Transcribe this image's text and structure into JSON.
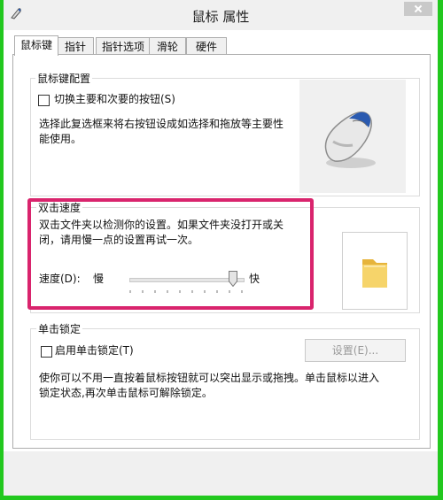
{
  "window": {
    "title": "鼠标 属性"
  },
  "tabs": [
    {
      "label": "鼠标键"
    },
    {
      "label": "指针"
    },
    {
      "label": "指针选项"
    },
    {
      "label": "滑轮"
    },
    {
      "label": "硬件"
    }
  ],
  "button_config": {
    "group_label": "鼠标键配置",
    "checkbox_label": "切换主要和次要的按钮(S)",
    "checked": false,
    "description_line1": "选择此复选框来将右按钮设成如选择和拖放等主要性",
    "description_line2": "能使用。"
  },
  "double_click": {
    "group_label": "双击速度",
    "description_line1": "双击文件夹以检测你的设置。如果文件夹没打开或关",
    "description_line2": "闭，请用慢一点的设置再试一次。",
    "speed_label": "速度(D):",
    "slow_label": "慢",
    "fast_label": "快",
    "speed_level": 0.95
  },
  "click_lock": {
    "group_label": "单击锁定",
    "checkbox_label": "启用单击锁定(T)",
    "checked": false,
    "settings_button": "设置(E)...",
    "settings_enabled": false,
    "description_line1": "使你可以不用一直按着鼠标按钮就可以突出显示或拖拽。单击鼠标以进入",
    "description_line2": "锁定状态,再次单击鼠标可解除锁定。"
  },
  "colors": {
    "highlight": "#d9246d",
    "frame": "#22c81e"
  }
}
